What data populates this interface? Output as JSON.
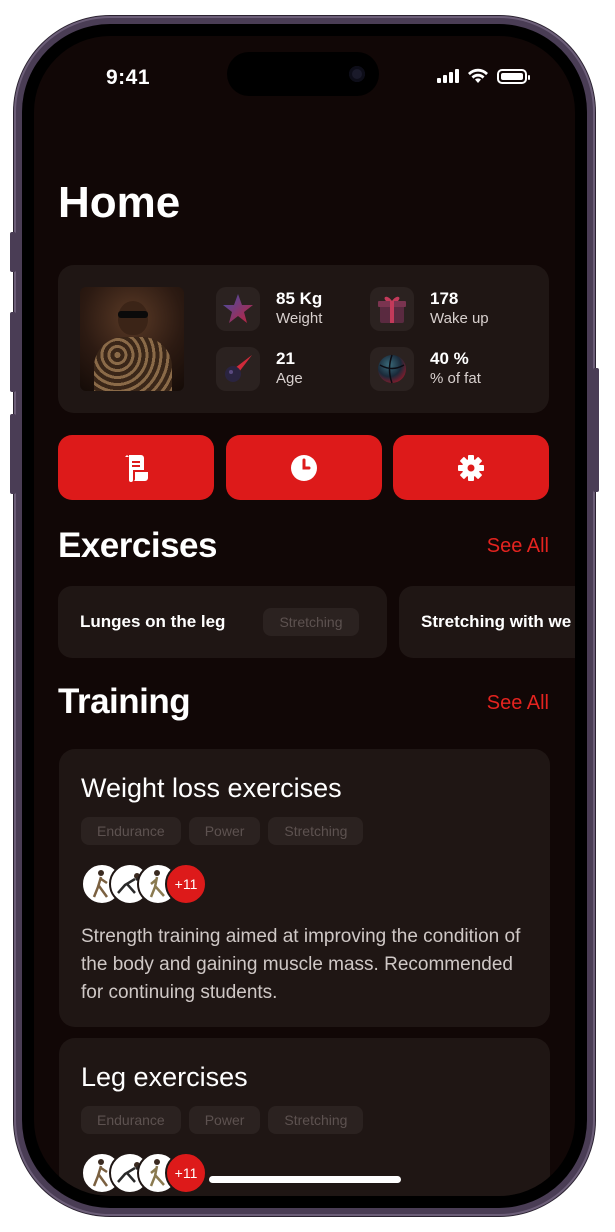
{
  "status_bar": {
    "time": "9:41"
  },
  "page_title": "Home",
  "profile": {
    "stats": [
      {
        "value": "85 Kg",
        "label": "Weight",
        "icon": "star-icon"
      },
      {
        "value": "178",
        "label": "Wake up",
        "icon": "gift-icon"
      },
      {
        "value": "21",
        "label": "Age",
        "icon": "comet-icon"
      },
      {
        "value": "40 %",
        "label": "% of fat",
        "icon": "ball-icon"
      }
    ]
  },
  "actions": [
    {
      "icon": "scroll-icon"
    },
    {
      "icon": "clock-icon"
    },
    {
      "icon": "gear-icon"
    }
  ],
  "exercises": {
    "title": "Exercises",
    "see_all": "See All",
    "items": [
      {
        "name": "Lunges on the leg",
        "tag": "Stretching"
      },
      {
        "name": "Stretching with we"
      }
    ]
  },
  "training": {
    "title": "Training",
    "see_all": "See All",
    "items": [
      {
        "title": "Weight loss exercises",
        "tags": [
          "Endurance",
          "Power",
          "Stretching"
        ],
        "more": "+11",
        "description": "Strength training aimed at improving the condition of the body and gaining muscle mass. Recommended for continuing students."
      },
      {
        "title": "Leg exercises",
        "tags": [
          "Endurance",
          "Power",
          "Stretching"
        ],
        "more": "+11"
      }
    ]
  },
  "colors": {
    "accent": "#dd1a1a",
    "background": "#110706",
    "card": "#1f1614"
  }
}
